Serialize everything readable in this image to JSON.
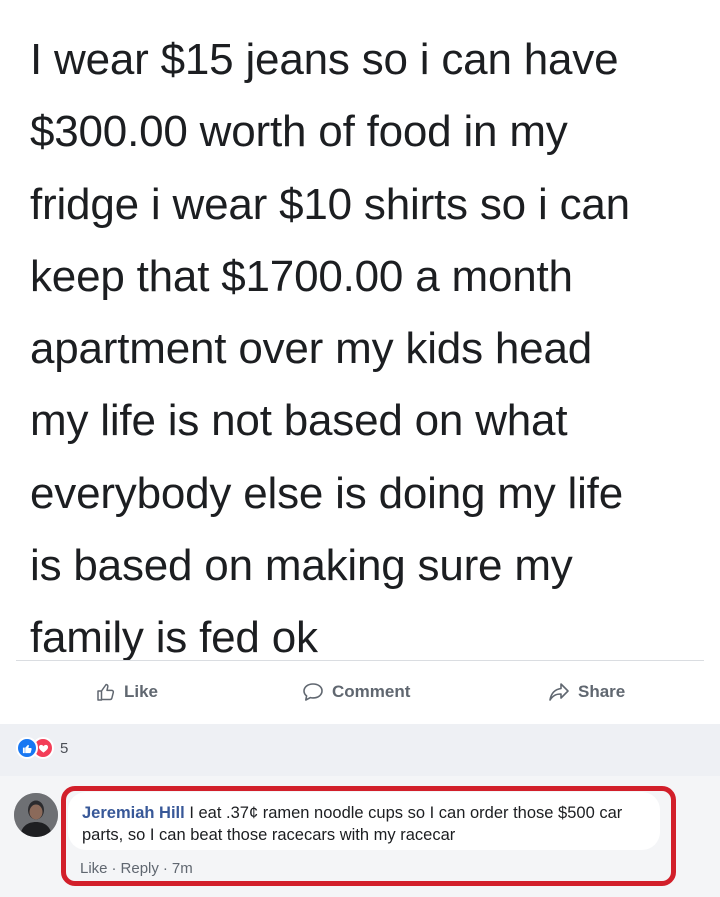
{
  "post": {
    "lines": [
      "I wear $15 jeans so i can have",
      "$300.00 worth of food in my",
      "fridge i wear $10 shirts so i can",
      "keep that $1700.00 a month",
      "apartment over my kids head",
      "my life is not based on what",
      "everybody else is doing my life",
      "is based on making sure my",
      "family is fed ok"
    ]
  },
  "actions": {
    "like": "Like",
    "comment": "Comment",
    "share": "Share"
  },
  "reactions": {
    "count": "5",
    "colors": {
      "like": "#1877f2",
      "love": "#f33e58"
    }
  },
  "comment": {
    "author": "Jeremiah Hill",
    "text": "I eat .37¢ ramen noodle cups so I can order those $500 car parts, so I can beat those racecars with my racecar",
    "like": "Like",
    "separator": "·",
    "reply": "Reply",
    "time": "7m"
  },
  "colors": {
    "highlight": "#d21f2a",
    "author_link": "#385898",
    "action_gray": "#606770"
  },
  "icons": {
    "like": "thumbs-up-icon",
    "comment": "speech-bubble-icon",
    "share": "share-arrow-icon"
  }
}
